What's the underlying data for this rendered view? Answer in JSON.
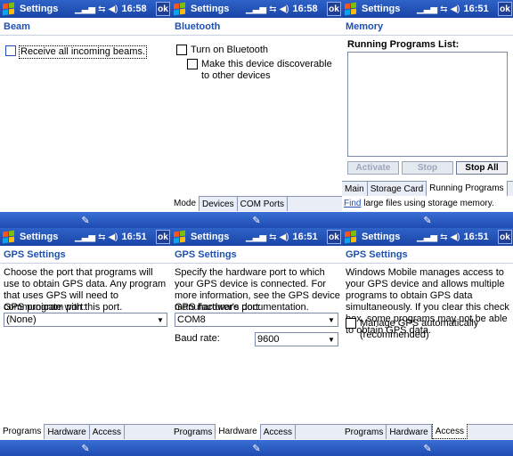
{
  "panes": [
    {
      "title": "Settings",
      "time": "16:58",
      "ok": "ok",
      "header": "Beam",
      "checkbox_label": "Receive all incoming beams."
    },
    {
      "title": "Settings",
      "time": "16:58",
      "ok": "ok",
      "header": "Bluetooth",
      "checkbox1_label": "Turn on Bluetooth",
      "checkbox2_label": "Make this device discoverable to other devices",
      "tabs": [
        "Mode",
        "Devices",
        "COM Ports"
      ]
    },
    {
      "title": "Settings",
      "time": "16:51",
      "ok": "ok",
      "header": "Memory",
      "list_label": "Running Programs List:",
      "buttons": [
        "Activate",
        "Stop",
        "Stop All"
      ],
      "tabs": [
        "Main",
        "Storage Card",
        "Running Programs"
      ],
      "footer_link": "Find",
      "footer_text": " large files using storage memory."
    },
    {
      "title": "Settings",
      "time": "16:51",
      "ok": "ok",
      "header": "GPS Settings",
      "description": "Choose the port that programs will use to obtain GPS data. Any program that uses GPS will need to communicate with this port.",
      "field_label": "GPS program port:",
      "field_value": "(None)",
      "tabs": [
        "Programs",
        "Hardware",
        "Access"
      ]
    },
    {
      "title": "Settings",
      "time": "16:51",
      "ok": "ok",
      "header": "GPS Settings",
      "description": "Specify the hardware port to which your GPS device is connected. For more information, see the GPS device manufacturer's documentation.",
      "field1_label": "GPS hardware port:",
      "field1_value": "COM8",
      "field2_label": "Baud rate:",
      "field2_value": "9600",
      "tabs": [
        "Programs",
        "Hardware",
        "Access"
      ]
    },
    {
      "title": "Settings",
      "time": "16:51",
      "ok": "ok",
      "header": "GPS Settings",
      "description": "Windows Mobile manages access to your GPS device and allows multiple programs to obtain GPS data simultaneously. If you clear this check box, some programs may not be able to obtain GPS data.",
      "checkbox_label": "Manage GPS automatically (recommended)",
      "tabs": [
        "Programs",
        "Hardware",
        "Access"
      ]
    }
  ],
  "colors": {
    "titlebar": "#1a44a6",
    "header": "#1f50b4"
  }
}
